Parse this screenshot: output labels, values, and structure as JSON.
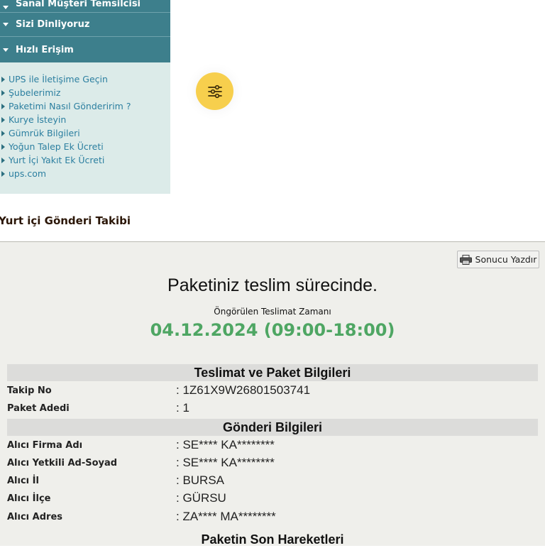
{
  "sidebar": {
    "menu": [
      {
        "label": "Sanal Müşteri Temsilcisi"
      },
      {
        "label": "Sizi Dinliyoruz"
      },
      {
        "label": "Hızlı Erişim"
      }
    ],
    "links": [
      "UPS ile İletişime Geçin",
      "Şubelerimiz",
      "Paketimi Nasıl Gönderirim ?",
      "Kurye İsteyin",
      "Gümrük Bilgileri",
      "Yoğun Talep Ek Ücreti",
      "Yurt İçi Yakıt Ek Ücreti",
      "ups.com"
    ]
  },
  "fab": {
    "icon": "sliders-icon",
    "color": "#f7cf4d"
  },
  "page_title": "Yurt içi Gönderi Takibi",
  "result": {
    "print_label": "Sonucu Yazdır",
    "status": "Paketiniz teslim sürecinde.",
    "eta_label": "Öngörülen Teslimat Zamanı",
    "eta_value": "04.12.2024 (09:00-18:00)",
    "eta_color": "#4ea663",
    "sections": [
      {
        "title": "Teslimat ve Paket Bilgileri",
        "rows": [
          {
            "key": "Takip No",
            "value": ": 1Z61X9W26801503741"
          },
          {
            "key": "Paket Adedi",
            "value": ": 1"
          }
        ]
      },
      {
        "title": "Gönderi Bilgileri",
        "rows": [
          {
            "key": "Alıcı Firma Adı",
            "value": ": SE**** KA********"
          },
          {
            "key": "Alıcı Yetkili Ad-Soyad",
            "value": ": SE**** KA********"
          },
          {
            "key": "Alıcı İl",
            "value": ": BURSA"
          },
          {
            "key": "Alıcı İlçe",
            "value": ": GÜRSU"
          },
          {
            "key": "Alıcı Adres",
            "value": ": ZA**** MA********"
          }
        ]
      },
      {
        "title": "Paketin Son Hareketleri"
      }
    ]
  }
}
